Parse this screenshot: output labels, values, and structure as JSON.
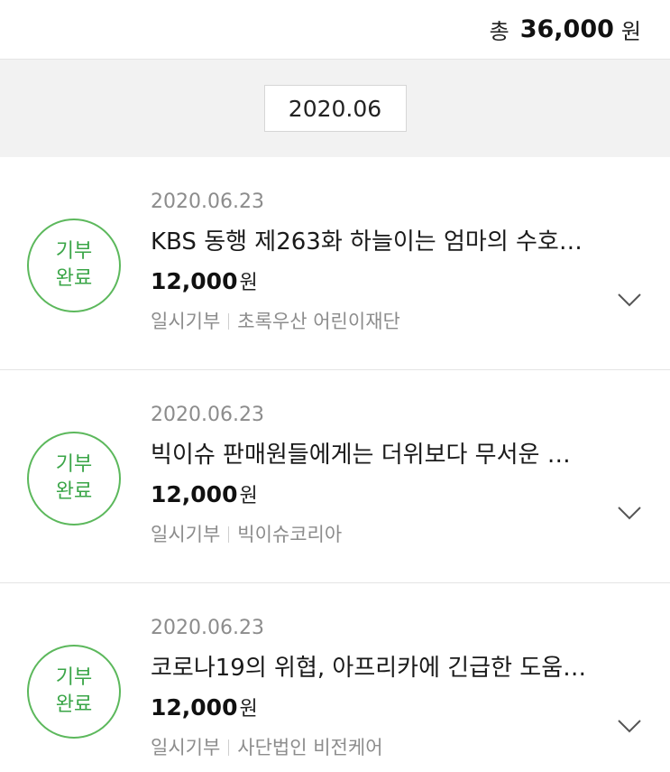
{
  "summary": {
    "total_label": "총",
    "total_amount": "36,000",
    "total_unit": "원"
  },
  "month_selector": {
    "value": "2020.06"
  },
  "donations": [
    {
      "badge_line1": "기부",
      "badge_line2": "완료",
      "date": "2020.06.23",
      "title": "KBS 동행 제263화 하늘이는 엄마의 수호…",
      "amount": "12,000",
      "unit": "원",
      "type": "일시기부",
      "organization": "초록우산 어린이재단"
    },
    {
      "badge_line1": "기부",
      "badge_line2": "완료",
      "date": "2020.06.23",
      "title": "빅이슈 판매원들에게는 더위보다 무서운 …",
      "amount": "12,000",
      "unit": "원",
      "type": "일시기부",
      "organization": "빅이슈코리아"
    },
    {
      "badge_line1": "기부",
      "badge_line2": "완료",
      "date": "2020.06.23",
      "title": "코로나19의 위협, 아프리카에 긴급한 도움…",
      "amount": "12,000",
      "unit": "원",
      "type": "일시기부",
      "organization": "사단법인 비전케어"
    }
  ],
  "colors": {
    "badge_green": "#3aa547",
    "muted_text": "#8c8c8c",
    "band_bg": "#f2f2f2"
  },
  "icons": {
    "expand": "chevron-down-icon"
  }
}
